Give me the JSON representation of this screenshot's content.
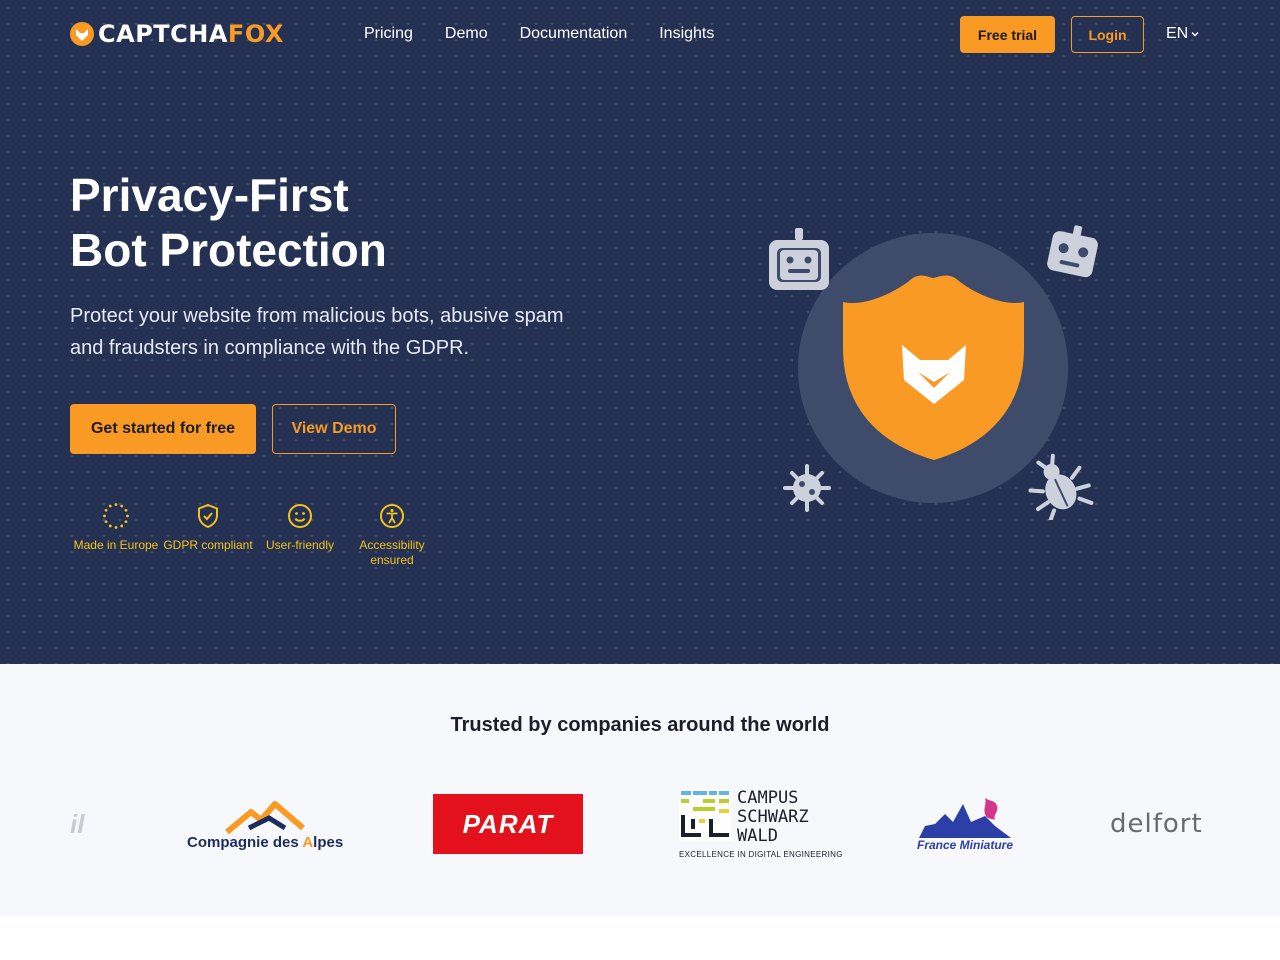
{
  "nav": {
    "logo_white": "CAPTCHA",
    "logo_orange": "FOX",
    "links": [
      "Pricing",
      "Demo",
      "Documentation",
      "Insights"
    ],
    "free_trial": "Free trial",
    "login": "Login",
    "language": "EN"
  },
  "hero": {
    "title_line1": "Privacy-First",
    "title_line2": "Bot Protection",
    "subtitle": "Protect your website from malicious bots, abusive spam and fraudsters in compliance with the GDPR.",
    "cta_primary": "Get started for free",
    "cta_secondary": "View Demo",
    "features": [
      {
        "icon": "eu-stars-icon",
        "label": "Made in Europe"
      },
      {
        "icon": "shield-check-icon",
        "label": "GDPR compliant"
      },
      {
        "icon": "smiley-icon",
        "label": "User-friendly"
      },
      {
        "icon": "accessibility-icon",
        "label": "Accessibility ensured"
      }
    ]
  },
  "trusted": {
    "title": "Trusted by companies around the world",
    "logos": {
      "partial_left": "il",
      "cda_main": "Compagnie des ",
      "cda_accent": "A",
      "cda_rest": "lpes",
      "parat": "PARAT",
      "campus_line1": "CAMPUS",
      "campus_line2": "SCHWARZ",
      "campus_line3": "WALD",
      "campus_sub": "EXCELLENCE IN DIGITAL ENGINEERING",
      "france_miniature": "France Miniature",
      "delfort": "delfort"
    }
  },
  "colors": {
    "hero_bg": "#243152",
    "accent": "#f99a25",
    "feature_text": "#f4c21c",
    "trusted_bg": "#f7f8fc"
  }
}
